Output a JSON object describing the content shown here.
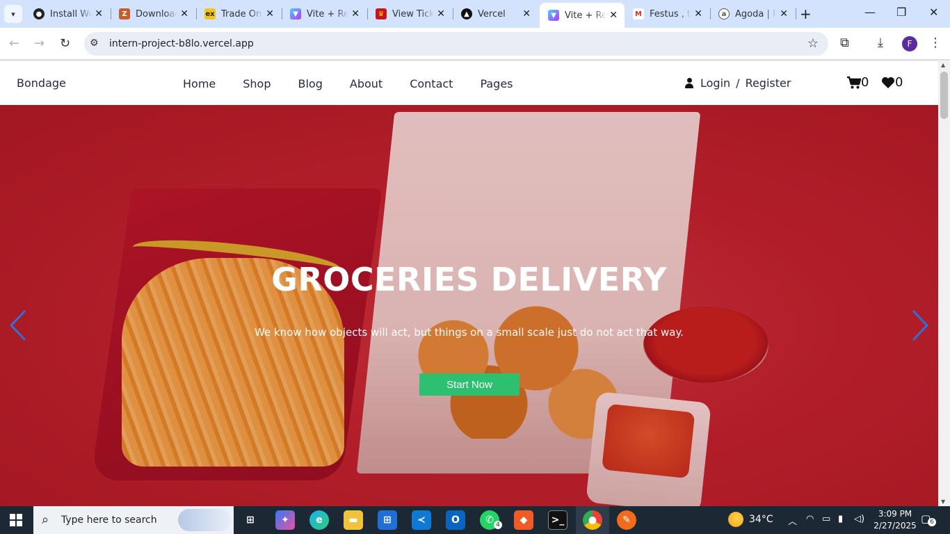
{
  "browser": {
    "tabs": [
      {
        "title": "Install Wo",
        "favicon": "github-icon",
        "color": "#222222"
      },
      {
        "title": "Downloac",
        "favicon": "download-site-icon",
        "color": "#c75b2a"
      },
      {
        "title": "Trade Onl",
        "favicon": "exness-icon",
        "color": "#f5c518"
      },
      {
        "title": "Vite + Re",
        "favicon": "vite-icon",
        "color": "#8f6bf2"
      },
      {
        "title": "View Tick",
        "favicon": "crown-icon",
        "color": "#c4161c"
      },
      {
        "title": "Vercel",
        "favicon": "vercel-icon",
        "color": "#111111"
      },
      {
        "title": "Vite + Re",
        "favicon": "vite-icon",
        "color": "#8f6bf2",
        "active": true
      },
      {
        "title": "Festus , tc",
        "favicon": "gmail-icon",
        "color": "#d93025"
      },
      {
        "title": "Agoda | H",
        "favicon": "agoda-icon",
        "color": "#555555"
      }
    ],
    "url": "intern-project-b8lo.vercel.app",
    "profile_initial": "F"
  },
  "site": {
    "brand": "Bondage",
    "nav": [
      "Home",
      "Shop",
      "Blog",
      "About",
      "Contact",
      "Pages"
    ],
    "login": "Login",
    "separator": "/",
    "register": "Register",
    "cart_count": "0",
    "wishlist_count": "0"
  },
  "hero": {
    "title": "GROCERIES DELIVERY",
    "subtitle": "We know how objects will act, but things on a small scale just do not act that way.",
    "button": "Start Now",
    "button_color": "#2dc071",
    "arrow_color": "#2f6fe0"
  },
  "taskbar": {
    "search_placeholder": "Type here to search",
    "whatsapp_badge": "4",
    "weather": "34°C",
    "time": "3:09 PM",
    "date": "2/27/2025",
    "notification_count": "6"
  }
}
